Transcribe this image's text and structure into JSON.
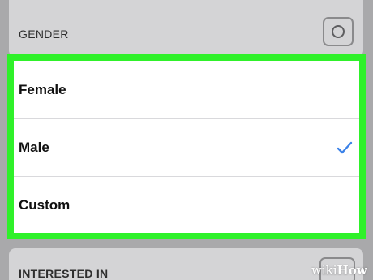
{
  "gender_section": {
    "label": "GENDER",
    "privacy_icon": "circle-icon"
  },
  "gender_options": [
    {
      "label": "Female",
      "selected": false
    },
    {
      "label": "Male",
      "selected": true
    },
    {
      "label": "Custom",
      "selected": false
    }
  ],
  "interested_section": {
    "label": "INTERESTED IN",
    "privacy_icon": "privacy-icon"
  },
  "watermark": {
    "prefix": "wiki",
    "suffix": "How"
  },
  "colors": {
    "highlight": "#2ff12a",
    "checkmark": "#3b82e8",
    "background": "#a9a9ab"
  }
}
